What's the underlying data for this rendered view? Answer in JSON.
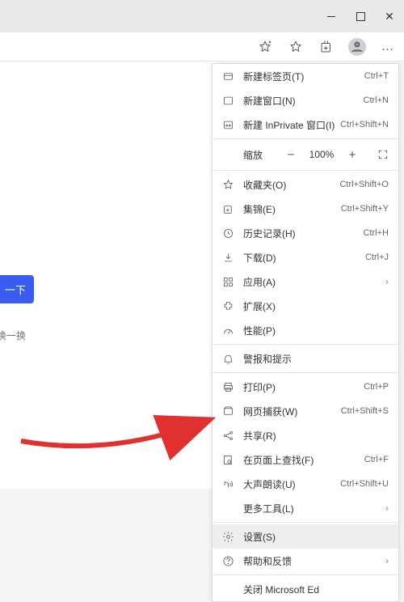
{
  "window": {
    "close_glyph": "✕"
  },
  "toolbar": {
    "more_glyph": "…"
  },
  "page": {
    "search_btn": "一下",
    "swap": "换一换"
  },
  "zoom": {
    "label": "缩放",
    "value": "100%",
    "minus": "−",
    "plus": "+"
  },
  "menu": {
    "new_tab": {
      "label": "新建标签页(T)",
      "shortcut": "Ctrl+T"
    },
    "new_window": {
      "label": "新建窗口(N)",
      "shortcut": "Ctrl+N"
    },
    "new_inprivate": {
      "label": "新建 InPrivate 窗口(I)",
      "shortcut": "Ctrl+Shift+N"
    },
    "favorites": {
      "label": "收藏夹(O)",
      "shortcut": "Ctrl+Shift+O"
    },
    "collections": {
      "label": "集锦(E)",
      "shortcut": "Ctrl+Shift+Y"
    },
    "history": {
      "label": "历史记录(H)",
      "shortcut": "Ctrl+H"
    },
    "downloads": {
      "label": "下载(D)",
      "shortcut": "Ctrl+J"
    },
    "apps": {
      "label": "应用(A)"
    },
    "extensions": {
      "label": "扩展(X)"
    },
    "performance": {
      "label": "性能(P)"
    },
    "alerts": {
      "label": "警报和提示"
    },
    "print": {
      "label": "打印(P)",
      "shortcut": "Ctrl+P"
    },
    "capture": {
      "label": "网页捕获(W)",
      "shortcut": "Ctrl+Shift+S"
    },
    "share": {
      "label": "共享(R)"
    },
    "find": {
      "label": "在页面上查找(F)",
      "shortcut": "Ctrl+F"
    },
    "read_aloud": {
      "label": "大声朗读(U)",
      "shortcut": "Ctrl+Shift+U"
    },
    "more_tools": {
      "label": "更多工具(L)"
    },
    "settings": {
      "label": "设置(S)"
    },
    "help": {
      "label": "帮助和反馈"
    },
    "close_edge": {
      "label": "关闭 Microsoft Ed"
    },
    "chevron": "›"
  }
}
